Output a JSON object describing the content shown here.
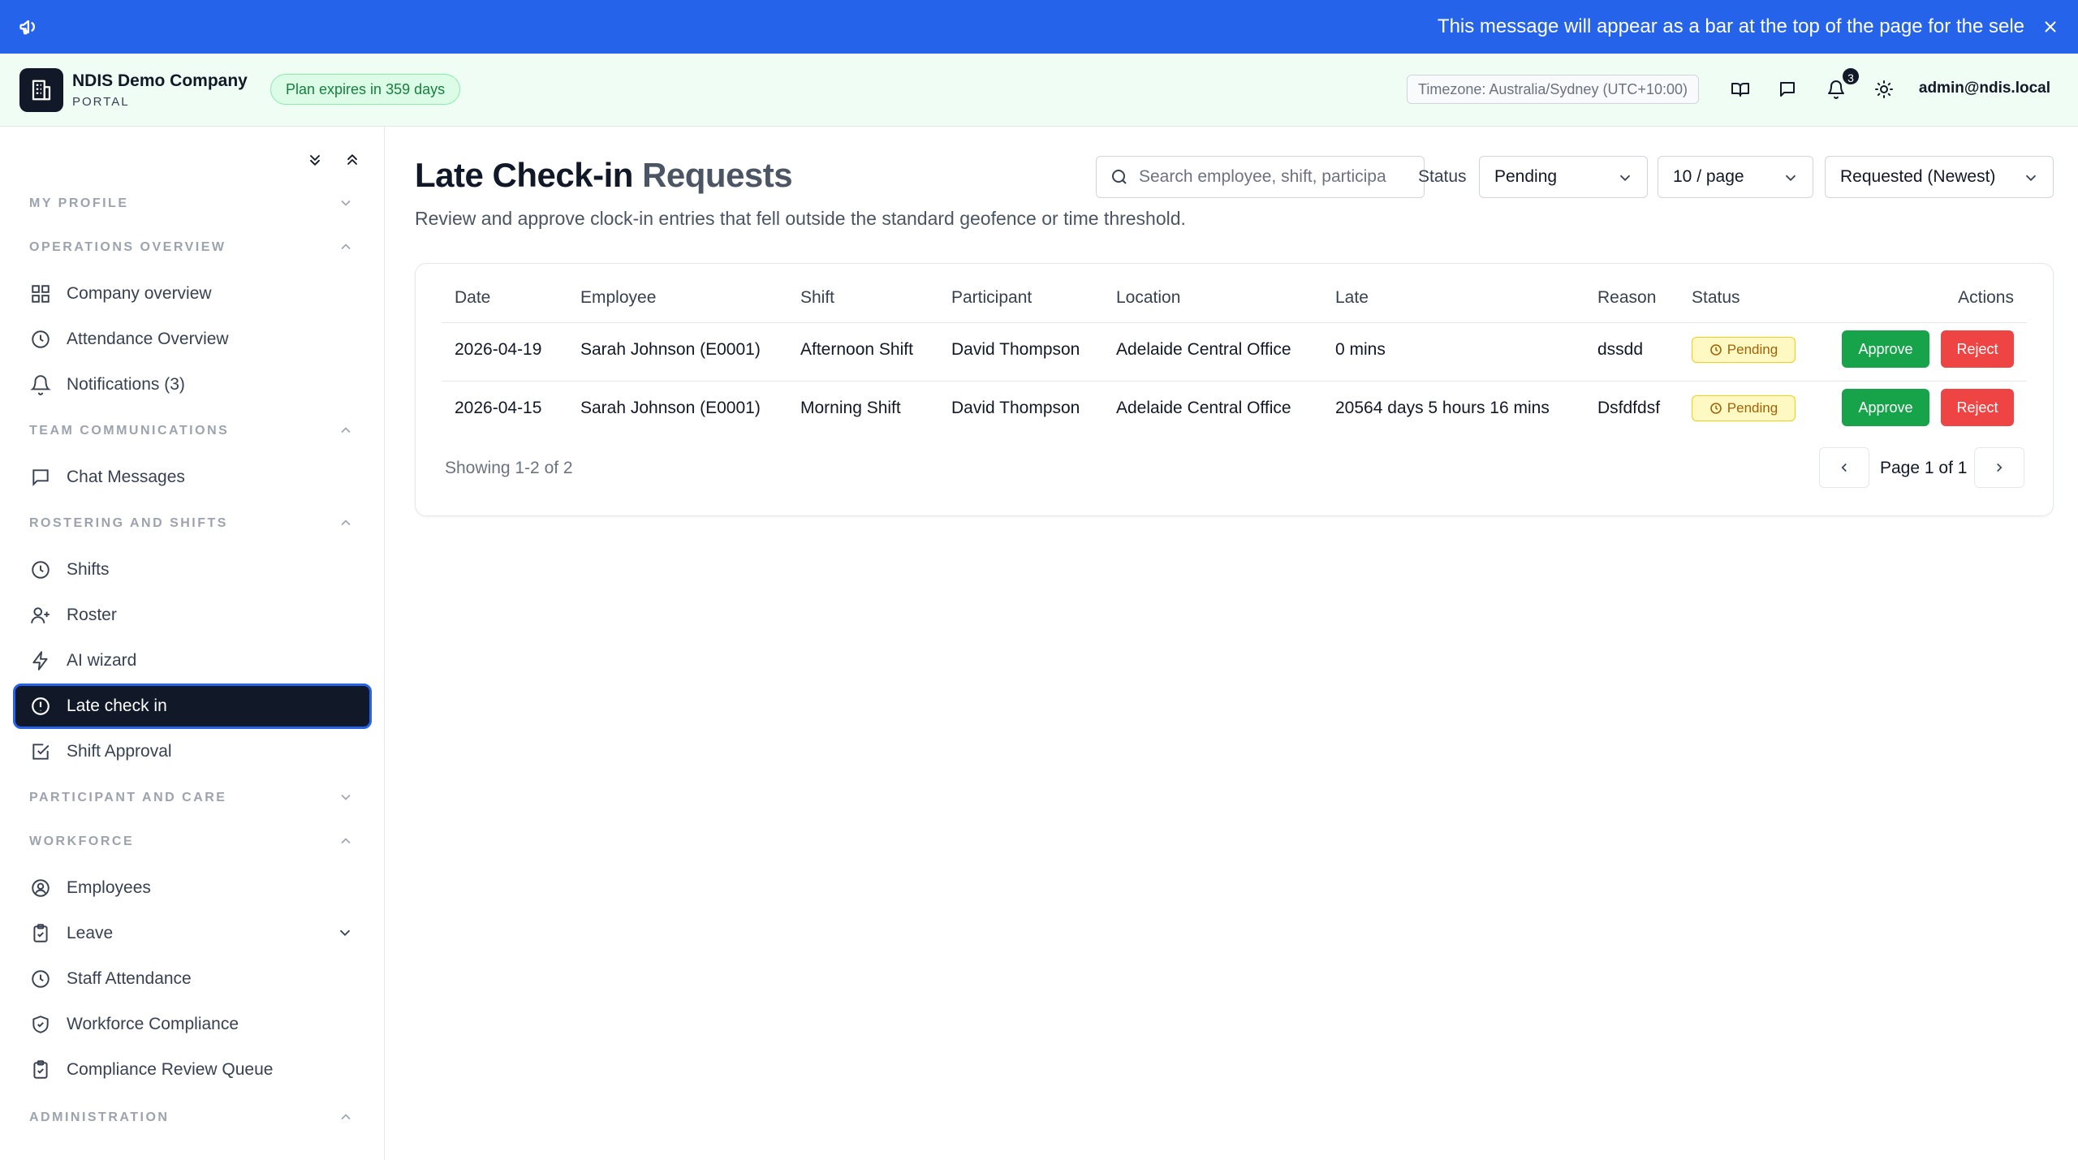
{
  "announcement": {
    "message": "This message will appear as a bar at the top of the page for the sele",
    "icon": "megaphone-icon",
    "close_icon": "close-icon",
    "color": "#2563eb"
  },
  "header": {
    "company_name": "NDIS Demo Company",
    "portal_label": "PORTAL",
    "plan_badge": "Plan expires in 359 days",
    "timezone": "Timezone: Australia/Sydney (UTC+10:00)",
    "notification_count": "3",
    "user_email": "admin@ndis.local",
    "icons": [
      "book-icon",
      "chat-icon",
      "bell-icon",
      "sun-icon"
    ]
  },
  "sidebar": {
    "sections": {
      "my_profile": "MY PROFILE",
      "operations_overview": "OPERATIONS OVERVIEW",
      "team_communications": "TEAM COMMUNICATIONS",
      "rostering_and_shifts": "ROSTERING AND SHIFTS",
      "participant_and_care": "PARTICIPANT AND CARE",
      "workforce": "WORKFORCE",
      "administration": "ADMINISTRATION"
    },
    "items": {
      "company_overview": "Company overview",
      "attendance_overview": "Attendance Overview",
      "notifications": "Notifications (3)",
      "chat_messages": "Chat Messages",
      "shifts": "Shifts",
      "roster": "Roster",
      "ai_wizard": "AI wizard",
      "late_check_in": "Late check in",
      "shift_approval": "Shift Approval",
      "employees": "Employees",
      "leave": "Leave",
      "staff_attendance": "Staff Attendance",
      "workforce_compliance": "Workforce Compliance",
      "compliance_review_queue": "Compliance Review Queue"
    },
    "active_item": "late_check_in"
  },
  "page": {
    "title_part1": "Late Check-in",
    "title_part2": "Requests",
    "subtitle": "Review and approve clock-in entries that fell outside the standard geofence or time threshold."
  },
  "filters": {
    "search_placeholder": "Search employee, shift, participa",
    "search_value": "",
    "status_label": "Status",
    "status_value": "Pending",
    "page_size": "10 / page",
    "sort": "Requested (Newest)"
  },
  "table": {
    "headers": {
      "date": "Date",
      "employee": "Employee",
      "shift": "Shift",
      "participant": "Participant",
      "location": "Location",
      "late": "Late",
      "reason": "Reason",
      "status": "Status",
      "actions": "Actions"
    },
    "rows": [
      {
        "date": "2026-04-19",
        "employee": "Sarah Johnson (E0001)",
        "shift": "Afternoon Shift",
        "participant": "David Thompson",
        "location": "Adelaide Central Office",
        "late": "0 mins",
        "reason": "dssdd",
        "status": "Pending",
        "approve": "Approve",
        "reject": "Reject"
      },
      {
        "date": "2026-04-15",
        "employee": "Sarah Johnson (E0001)",
        "shift": "Morning Shift",
        "participant": "David Thompson",
        "location": "Adelaide Central Office",
        "late": "20564 days 5 hours 16 mins",
        "reason": "Dsfdfdsf",
        "status": "Pending",
        "approve": "Approve",
        "reject": "Reject"
      }
    ],
    "showing": "Showing 1-2 of 2",
    "page_info": "Page 1 of 1"
  },
  "colors": {
    "approve": "#16a34a",
    "reject": "#ef4444",
    "pending_bg": "#fef9c3",
    "active_nav": "#111827"
  }
}
